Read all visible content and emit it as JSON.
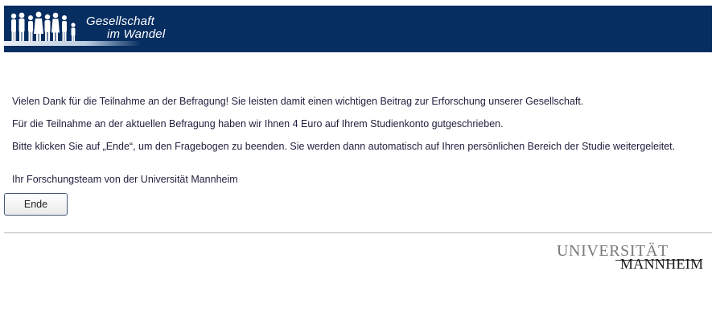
{
  "header": {
    "logo_line1": "Gesellschaft",
    "logo_line2": "im Wandel",
    "banner_color": "#072e61"
  },
  "content": {
    "thanks": "Vielen Dank für die Teilnahme an der Befragung! Sie leisten damit einen wichtigen Beitrag zur Erforschung unserer Gesellschaft.",
    "credit": "Für die Teilnahme an der aktuellen Befragung haben wir Ihnen 4 Euro auf Ihrem Studienkonto gutgeschrieben.",
    "instruction": "Bitte klicken Sie auf „Ende“, um den Fragebogen zu beenden. Sie werden dann automatisch auf Ihren persönlichen Bereich der Studie weitergeleitet.",
    "signature": "Ihr Forschungsteam von der Universität Mannheim"
  },
  "buttons": {
    "end_label": "Ende"
  },
  "footer": {
    "uni_line1": "UNIVERSITÄT",
    "uni_line2": "MANNHEIM"
  }
}
